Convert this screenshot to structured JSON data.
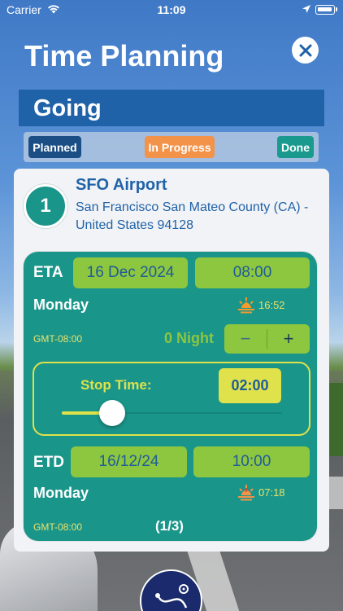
{
  "status_bar": {
    "carrier": "Carrier",
    "time": "11:09"
  },
  "header": {
    "title": "Time Planning"
  },
  "section": {
    "title": "Going"
  },
  "status_tabs": {
    "planned": "Planned",
    "in_progress": "In Progress",
    "done": "Done"
  },
  "stop": {
    "number": "1",
    "name": "SFO Airport",
    "address": "San Francisco San Mateo County (CA) - United States 94128"
  },
  "eta": {
    "label": "ETA",
    "date": "16 Dec 2024",
    "time": "08:00",
    "day": "Monday",
    "sunset": "16:52",
    "gmt": "GMT-08:00"
  },
  "nights": {
    "text": "0 Night",
    "minus": "−",
    "plus": "+"
  },
  "stop_time": {
    "label": "Stop Time:",
    "value": "02:00",
    "slider_fraction": 0.23
  },
  "etd": {
    "label": "ETD",
    "date": "16/12/24",
    "time": "10:00",
    "day": "Monday",
    "sunrise": "07:18",
    "gmt": "GMT-08:00"
  },
  "pager": {
    "text": "(1/3)"
  },
  "colors": {
    "teal": "#1a958a",
    "navy": "#1f62a8",
    "green": "#8dc63f",
    "yellow": "#dfe24a",
    "orange": "#f3934a"
  }
}
